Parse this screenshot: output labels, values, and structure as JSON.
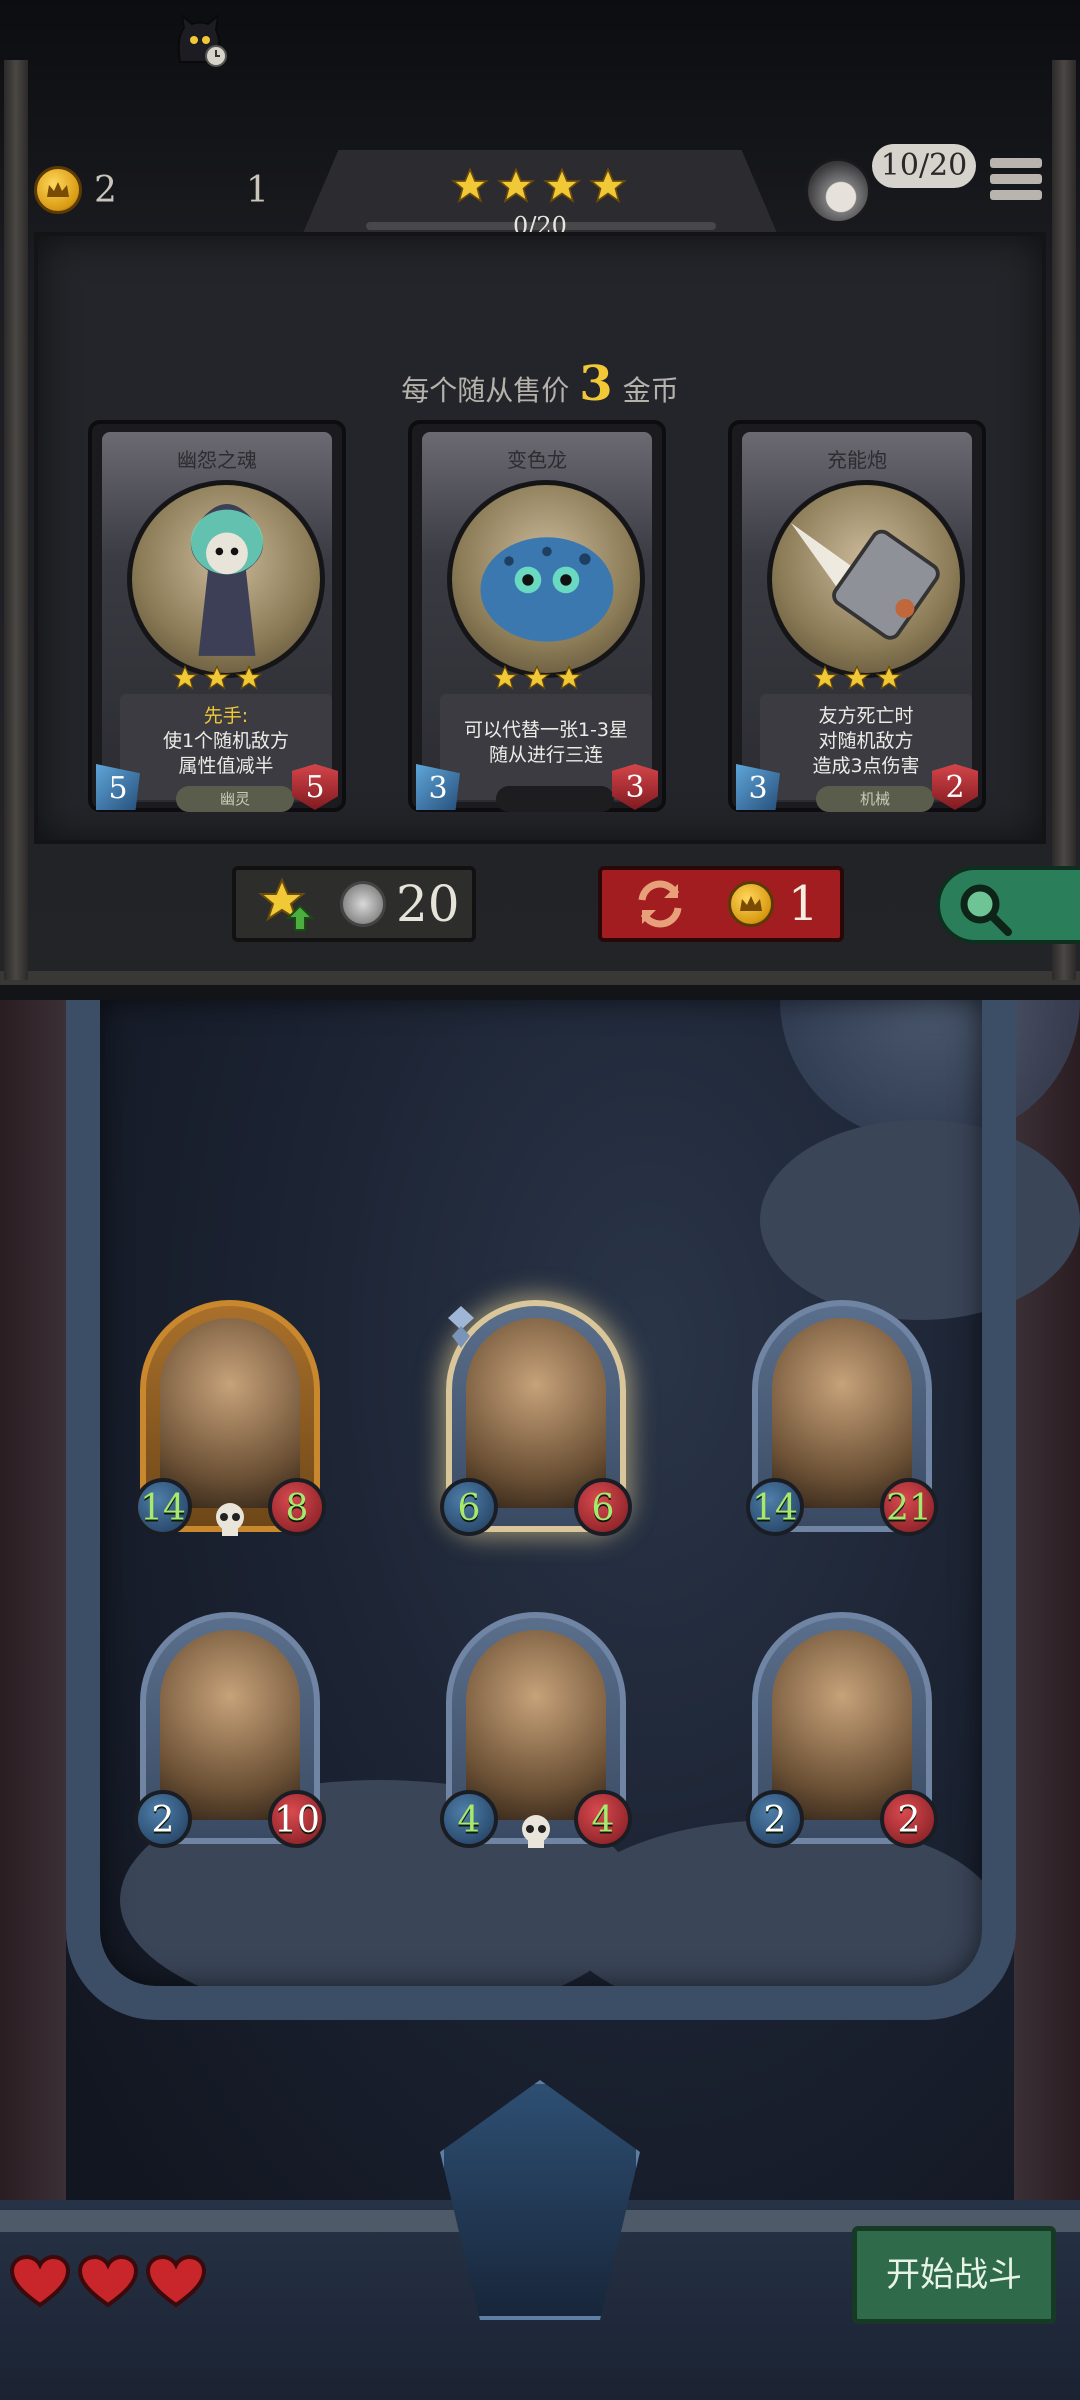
{
  "hud": {
    "gold": "2",
    "turn": "1",
    "progress": "0/20",
    "star_count": 4,
    "population": "10/20"
  },
  "shop": {
    "sell_prefix": "每个随从售价",
    "sell_price": "3",
    "sell_suffix": "金币",
    "cards": [
      {
        "name": "幽怨之魂",
        "stars": 3,
        "desc_highlight": "先手:",
        "desc": "使1个随机敌方\n属性值减半",
        "attack": "5",
        "health": "5",
        "tribe": "幽灵"
      },
      {
        "name": "变色龙",
        "stars": 3,
        "desc_highlight": "",
        "desc": "可以代替一张1-3星\n随从进行三连",
        "attack": "3",
        "health": "3",
        "tribe": ""
      },
      {
        "name": "充能炮",
        "stars": 3,
        "desc_highlight": "",
        "desc": "友方死亡时\n对随机敌方\n造成3点伤害",
        "attack": "3",
        "health": "2",
        "tribe": "机械"
      }
    ],
    "upgrade_cost": "20",
    "refresh_cost": "1"
  },
  "board": {
    "minions": [
      {
        "attack": "14",
        "health": "8",
        "attack_buffed": true,
        "health_buffed": true,
        "frame": "gold",
        "skull": true,
        "selected": false
      },
      {
        "attack": "6",
        "health": "6",
        "attack_buffed": true,
        "health_buffed": true,
        "frame": "silver",
        "skull": false,
        "selected": true
      },
      {
        "attack": "14",
        "health": "21",
        "attack_buffed": true,
        "health_buffed": true,
        "frame": "silver",
        "skull": false,
        "selected": false
      },
      {
        "attack": "2",
        "health": "10",
        "attack_buffed": false,
        "health_buffed": false,
        "frame": "silver",
        "skull": false,
        "selected": false
      },
      {
        "attack": "4",
        "health": "4",
        "attack_buffed": true,
        "health_buffed": true,
        "frame": "silver",
        "skull": true,
        "selected": false
      },
      {
        "attack": "2",
        "health": "2",
        "attack_buffed": false,
        "health_buffed": false,
        "frame": "silver",
        "skull": false,
        "selected": false
      }
    ]
  },
  "lives": 3,
  "start_battle_label": "开始战斗",
  "colors": {
    "gold": "#f1c936",
    "refresh_red": "#a11d20",
    "battle_green": "#2f6b4a",
    "buff_green": "#a7e86e"
  }
}
